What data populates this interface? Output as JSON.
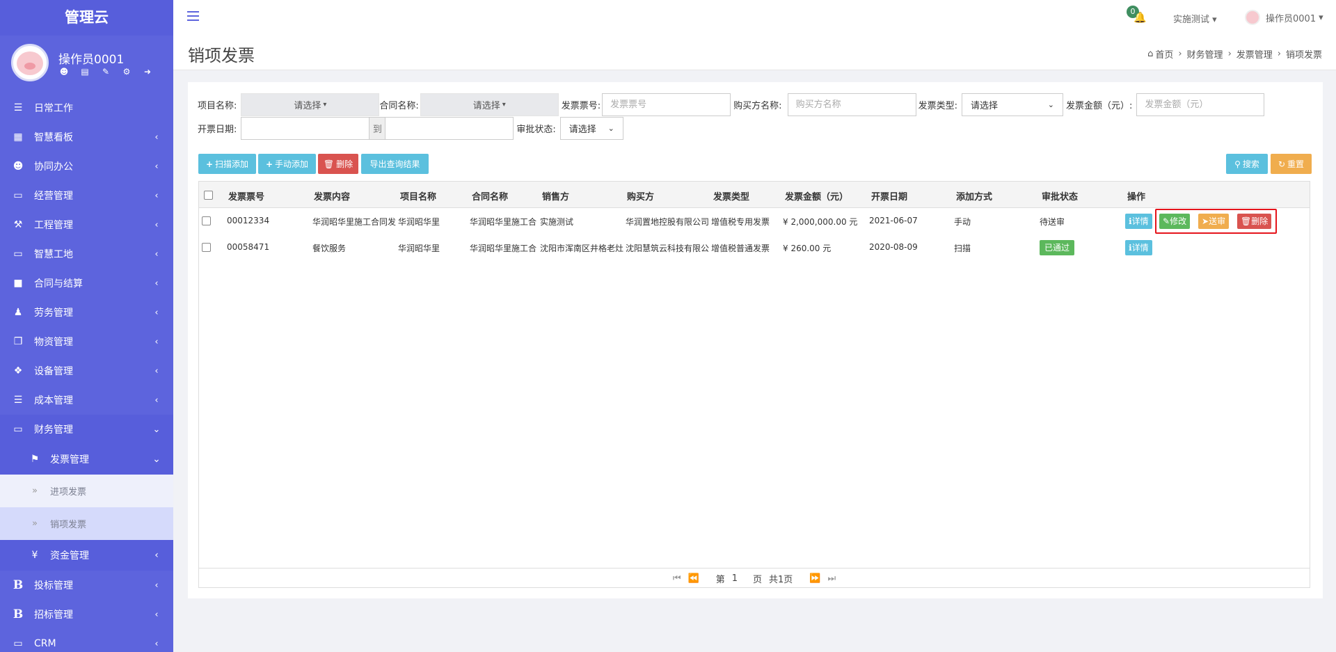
{
  "app": {
    "brand": "管理云"
  },
  "profile": {
    "name": "操作员0001",
    "icons": [
      "user-icon",
      "id-card-icon",
      "edit-icon",
      "key-icon",
      "logout-icon"
    ]
  },
  "sidebar": {
    "items": [
      {
        "label": "日常工作",
        "icon": "list-icon",
        "caret": ""
      },
      {
        "label": "智慧看板",
        "icon": "dashboard-icon",
        "caret": "‹"
      },
      {
        "label": "协同办公",
        "icon": "users-icon",
        "caret": "‹"
      },
      {
        "label": "经营管理",
        "icon": "desktop-icon",
        "caret": "‹"
      },
      {
        "label": "工程管理",
        "icon": "gavel-icon",
        "caret": "‹"
      },
      {
        "label": "智慧工地",
        "icon": "desktop-icon",
        "caret": "‹"
      },
      {
        "label": "合同与结算",
        "icon": "file-icon",
        "caret": "‹"
      },
      {
        "label": "劳务管理",
        "icon": "worker-icon",
        "caret": "‹"
      },
      {
        "label": "物资管理",
        "icon": "cube-icon",
        "caret": "‹"
      },
      {
        "label": "设备管理",
        "icon": "cubes-icon",
        "caret": "‹"
      },
      {
        "label": "成本管理",
        "icon": "list-icon",
        "caret": "‹"
      },
      {
        "label": "财务管理",
        "icon": "desktop-icon",
        "caret": "⌄"
      }
    ],
    "finance_sub": {
      "label": "发票管理",
      "icon": "tags-icon",
      "caret": "⌄"
    },
    "invoice_leaves": [
      {
        "label": "进项发票"
      },
      {
        "label": "销项发票"
      }
    ],
    "finance_sub2": {
      "label": "资金管理",
      "icon": "yen-icon",
      "caret": "‹"
    },
    "tail_items": [
      {
        "label": "投标管理",
        "icon": "bold-b-icon",
        "caret": "‹"
      },
      {
        "label": "招标管理",
        "icon": "bold-b-icon",
        "caret": "‹"
      },
      {
        "label": "CRM",
        "icon": "desktop-icon",
        "caret": "‹"
      }
    ]
  },
  "topbar": {
    "notification_count": "0",
    "org": "实施测试",
    "user": "操作员0001"
  },
  "page": {
    "title": "销项发票",
    "breadcrumb": [
      "首页",
      "财务管理",
      "发票管理",
      "销项发票"
    ]
  },
  "filters": {
    "project_label": "项目名称:",
    "project_value": "请选择",
    "contract_label": "合同名称:",
    "contract_value": "请选择",
    "invoice_no_label": "发票票号:",
    "invoice_no_placeholder": "发票票号",
    "buyer_label": "购买方名称:",
    "buyer_placeholder": "购买方名称",
    "type_label": "发票类型:",
    "type_value": "请选择",
    "amount_label": "发票金额（元）:",
    "amount_placeholder": "发票金额（元）",
    "date_label": "开票日期:",
    "date_to": "到",
    "approval_label": "审批状态:",
    "approval_value": "请选择"
  },
  "toolbar": {
    "scan_add": "扫描添加",
    "manual_add": "手动添加",
    "delete": "删除",
    "export": "导出查询结果",
    "search": "搜索",
    "reset": "重置"
  },
  "table": {
    "headers": [
      "发票票号",
      "发票内容",
      "项目名称",
      "合同名称",
      "销售方",
      "购买方",
      "发票类型",
      "发票金额（元）",
      "开票日期",
      "添加方式",
      "审批状态",
      "操作"
    ],
    "rows": [
      {
        "no": "00012334",
        "content": "华润昭华里施工合同发",
        "project": "华润昭华里",
        "contract": "华润昭华里施工合",
        "seller": "实施测试",
        "buyer": "华润置地控股有限公司",
        "type": "增值税专用发票",
        "amount": "¥ 2,000,000.00 元",
        "date": "2021-06-07",
        "method": "手动",
        "status": "待送审",
        "actions": [
          "详情",
          "修改",
          "送审",
          "删除"
        ]
      },
      {
        "no": "00058471",
        "content": "餐饮服务",
        "project": "华润昭华里",
        "contract": "华润昭华里施工合",
        "seller": "沈阳市浑南区井格老灶",
        "buyer": "沈阳慧筑云科技有限公",
        "type": "增值税普通发票",
        "amount": "¥ 260.00 元",
        "date": "2020-08-09",
        "method": "扫描",
        "status": "已通过",
        "actions": [
          "详情"
        ]
      }
    ]
  },
  "pager": {
    "page_prefix": "第",
    "current": "1",
    "page_suffix": "页",
    "total": "共1页"
  },
  "colors": {
    "sidebar": "#5d64dd",
    "cyan": "#5bc0de",
    "green": "#5cb85c",
    "orange": "#f0ad4e",
    "red": "#d9534f",
    "highlight": "#e5141b"
  }
}
